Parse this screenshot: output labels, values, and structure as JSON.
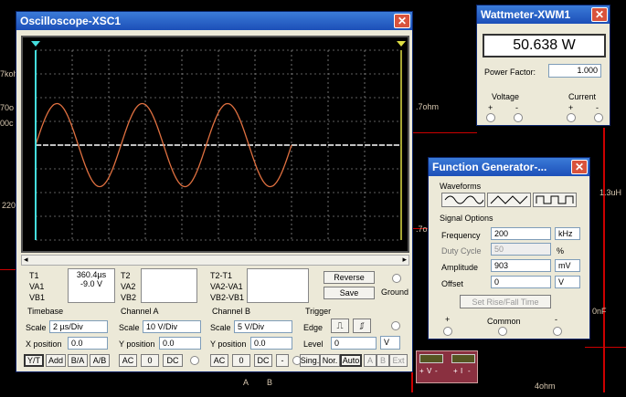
{
  "schematic": {
    "labels": [
      "7koh",
      "70o",
      "00c",
      "220",
      ".7ohm",
      ".7o",
      "1.3uH",
      "0nF",
      "4ohm",
      "A",
      "B",
      "+",
      "V",
      "-",
      "+",
      "I",
      "-"
    ]
  },
  "oscilloscope": {
    "title": "Oscilloscope-XSC1",
    "readout": {
      "t1_label": "T1",
      "t1_value": "360.4µs",
      "va1_label": "VA1",
      "va1_value": "-9.0 V",
      "vb1_label": "VB1",
      "t2_label": "T2",
      "va2_label": "VA2",
      "vb2_label": "VB2",
      "t21_label": "T2-T1",
      "va21_label": "VA2-VA1",
      "vb21_label": "VB2-VB1"
    },
    "reverse_label": "Reverse",
    "save_label": "Save",
    "ground_label": "Ground",
    "timebase": {
      "header": "Timebase",
      "scale_label": "Scale",
      "scale_value": "2 µs/Div",
      "xpos_label": "X position",
      "xpos_value": "0.0",
      "modes": [
        "Y/T",
        "Add",
        "B/A",
        "A/B"
      ]
    },
    "channel_a": {
      "header": "Channel A",
      "scale_label": "Scale",
      "scale_value": "10 V/Div",
      "ypos_label": "Y position",
      "ypos_value": "0.0",
      "coupling": [
        "AC",
        "0",
        "DC"
      ]
    },
    "channel_b": {
      "header": "Channel B",
      "scale_label": "Scale",
      "scale_value": "5 V/Div",
      "ypos_label": "Y position",
      "ypos_value": "0.0",
      "coupling": [
        "AC",
        "0",
        "DC",
        "-"
      ]
    },
    "trigger": {
      "header": "Trigger",
      "edge_label": "Edge",
      "level_label": "Level",
      "level_value": "0",
      "level_unit": "V",
      "modes": [
        "Sing.",
        "Nor.",
        "Auto",
        "A",
        "B",
        "Ext"
      ]
    },
    "trace": {
      "amplitude_div": 1.75,
      "cycles": 3,
      "color": "#e07040"
    }
  },
  "wattmeter": {
    "title": "Wattmeter-XWM1",
    "reading": "50.638 W",
    "pf_label": "Power Factor:",
    "pf_value": "1.000",
    "voltage_label": "Voltage",
    "current_label": "Current",
    "plus": "+",
    "minus": "-"
  },
  "function_generator": {
    "title": "Function Generator-...",
    "waveforms_label": "Waveforms",
    "signal_options_label": "Signal Options",
    "frequency_label": "Frequency",
    "frequency_value": "200",
    "frequency_unit": "kHz",
    "duty_label": "Duty Cycle",
    "duty_value": "50",
    "duty_unit": "%",
    "amplitude_label": "Amplitude",
    "amplitude_value": "903",
    "amplitude_unit": "mV",
    "offset_label": "Offset",
    "offset_value": "0",
    "offset_unit": "V",
    "rise_fall_label": "Set Rise/Fall Time",
    "plus": "+",
    "common_label": "Common",
    "minus": "-"
  }
}
